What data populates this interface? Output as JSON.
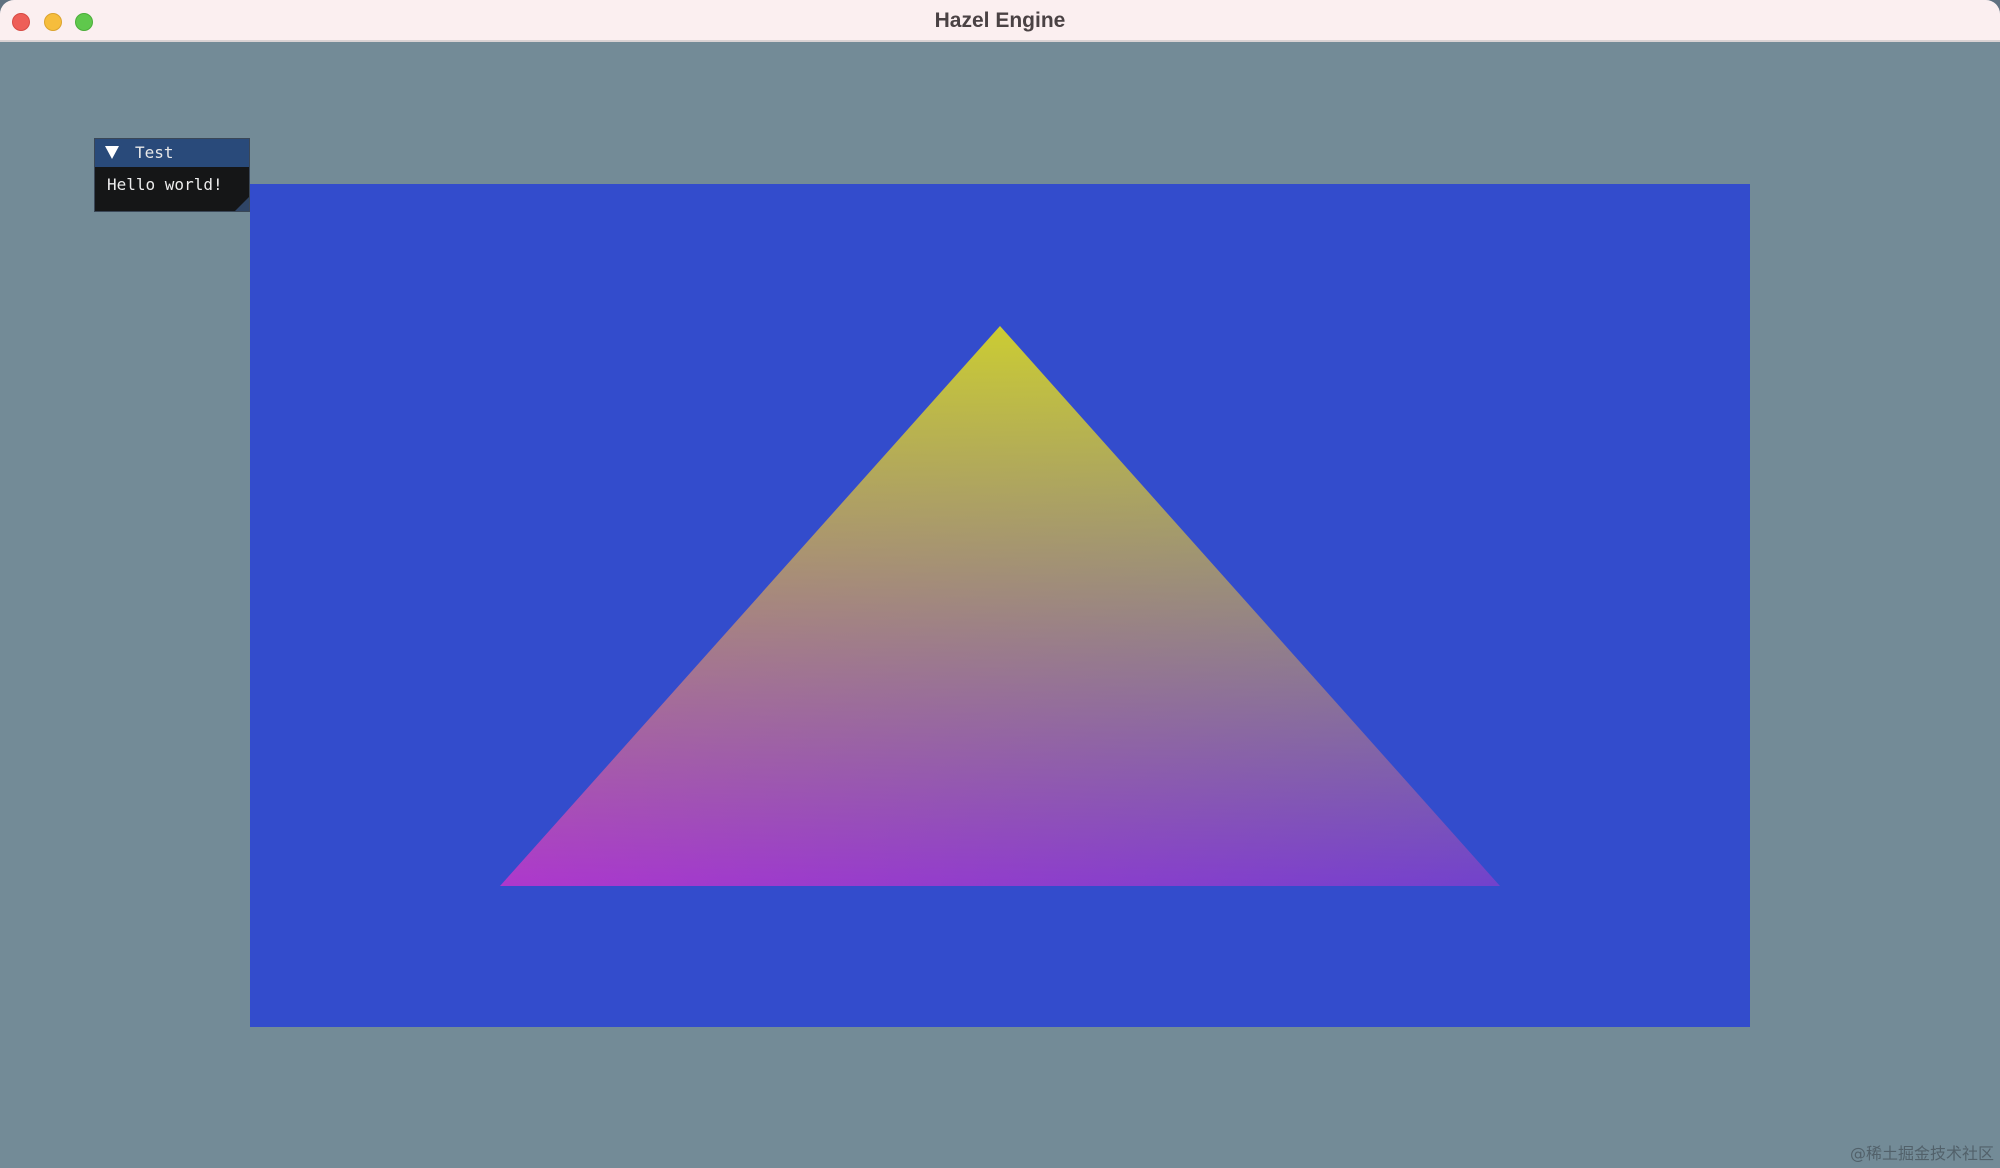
{
  "window": {
    "title": "Hazel Engine"
  },
  "traffic_lights": {
    "close_color": "#ee5f58",
    "minimize_color": "#f6bd3c",
    "maximize_color": "#5fc84c"
  },
  "scene": {
    "clear_color": "#738b97",
    "viewport_color": "#334ccc",
    "triangle_vertex_colors": {
      "top": "#cccc33",
      "bottom_left": "#cc33cc",
      "bottom_right": "#334ccc"
    }
  },
  "imgui_panel": {
    "title": "Test",
    "collapse_icon": "triangle-down-icon",
    "body_text": "Hello world!"
  },
  "watermark": "@稀土掘金技术社区"
}
